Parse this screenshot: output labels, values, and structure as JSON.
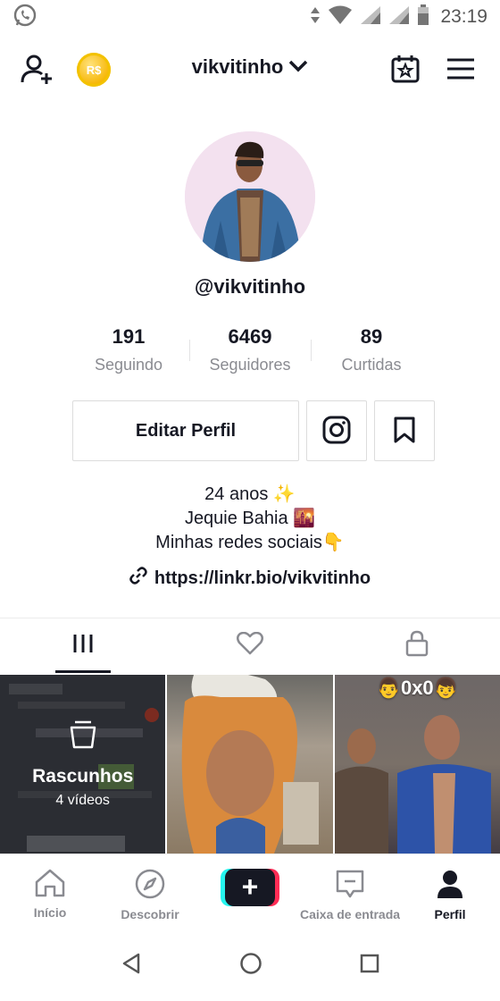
{
  "status_bar": {
    "time": "23:19",
    "icons": [
      "whatsapp-icon",
      "data-arrows-icon",
      "wifi-icon",
      "signal-icon",
      "signal-icon",
      "battery-icon"
    ]
  },
  "header": {
    "username": "vikvitinho",
    "coin_label": "R$",
    "icons": [
      "add-user-icon",
      "coin-icon",
      "chevron-down-icon",
      "calendar-icon",
      "menu-icon"
    ]
  },
  "profile": {
    "handle": "@vikvitinho",
    "stats": [
      {
        "value": "191",
        "label": "Seguindo"
      },
      {
        "value": "6469",
        "label": "Seguidores"
      },
      {
        "value": "89",
        "label": "Curtidas"
      }
    ],
    "edit_label": "Editar Perfil",
    "bio_lines": [
      "24 anos ✨",
      "Jequie Bahia 🌇",
      "Minhas redes sociais👇"
    ],
    "link": "https://linkr.bio/vikvitinho"
  },
  "tabs": [
    {
      "icon": "grid-icon",
      "active": true
    },
    {
      "icon": "heart-icon",
      "active": false
    },
    {
      "icon": "lock-icon",
      "active": false
    }
  ],
  "grid": {
    "drafts_title": "Rascunhos",
    "drafts_count": "4 vídeos",
    "video2_caption": "👨0x0👦"
  },
  "bottom_nav": [
    {
      "label": "Início",
      "icon": "home-icon"
    },
    {
      "label": "Descobrir",
      "icon": "compass-icon"
    },
    {
      "label": "",
      "icon": "plus-icon"
    },
    {
      "label": "Caixa de entrada",
      "icon": "inbox-icon"
    },
    {
      "label": "Perfil",
      "icon": "profile-icon",
      "active": true
    }
  ],
  "colors": {
    "text": "#161823",
    "muted": "#8a8b91",
    "cyan": "#25f4ee",
    "pink": "#fe2c55",
    "coin": "#f6b400"
  }
}
